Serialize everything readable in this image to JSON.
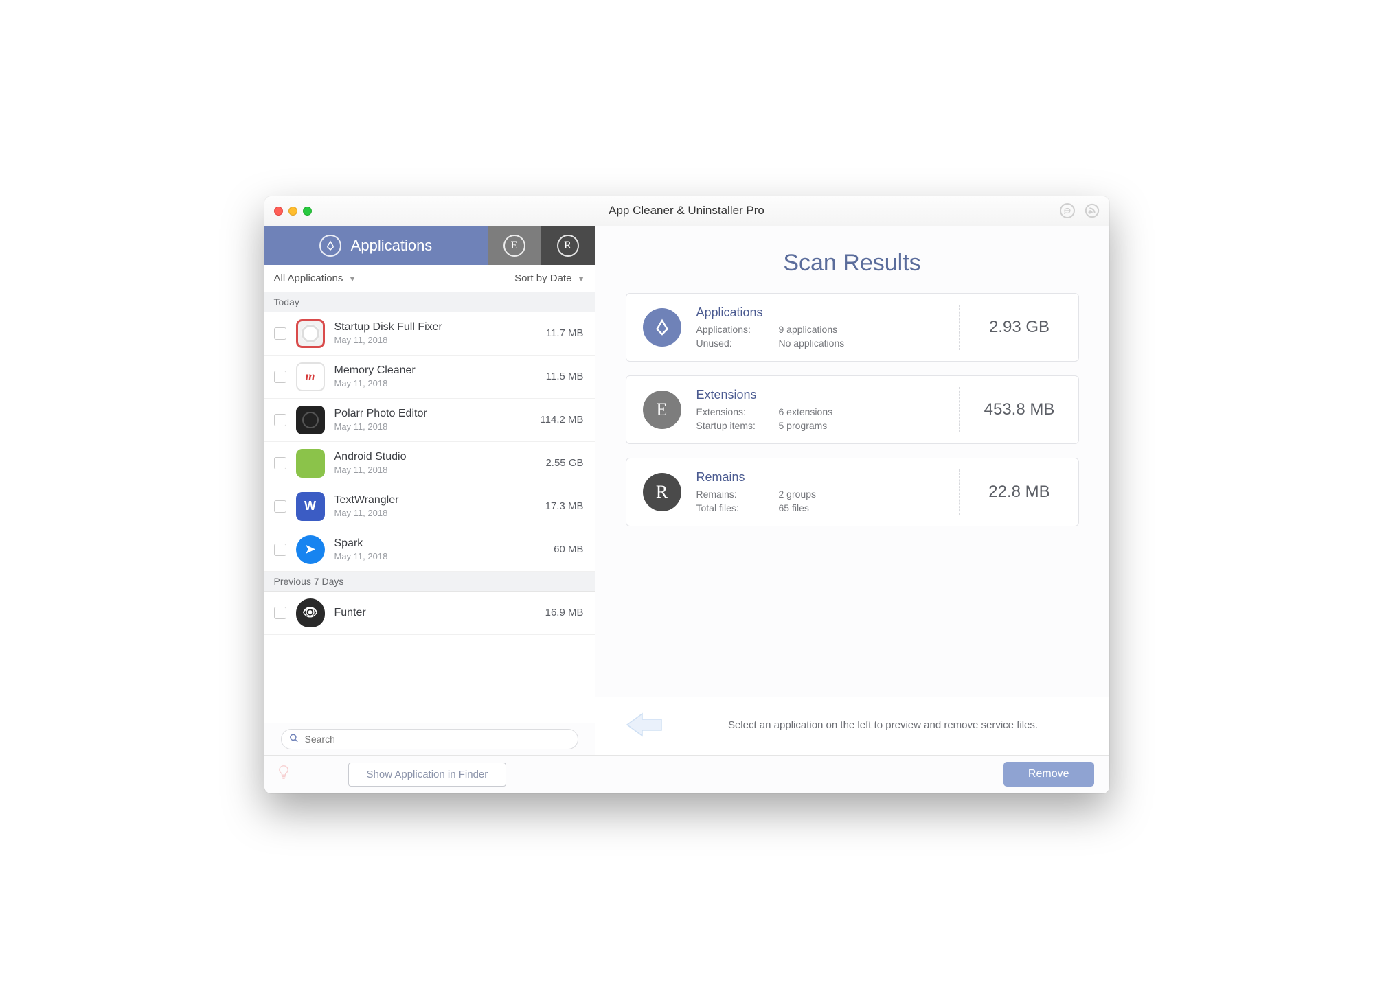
{
  "window_title": "App Cleaner & Uninstaller Pro",
  "tabs": {
    "applications_label": "Applications",
    "ext_glyph": "E",
    "rem_glyph": "R"
  },
  "filters": {
    "left": "All Applications",
    "right": "Sort by Date"
  },
  "sections": {
    "today": "Today",
    "prev7": "Previous 7 Days"
  },
  "apps_today": [
    {
      "name": "Startup Disk Full Fixer",
      "date": "May 11, 2018",
      "size": "11.7 MB",
      "icon": "ic-sdff",
      "glyph": ""
    },
    {
      "name": "Memory Cleaner",
      "date": "May 11, 2018",
      "size": "11.5 MB",
      "icon": "ic-mem",
      "glyph": "m"
    },
    {
      "name": "Polarr Photo Editor",
      "date": "May 11, 2018",
      "size": "114.2 MB",
      "icon": "ic-polarr",
      "glyph": ""
    },
    {
      "name": "Android Studio",
      "date": "May 11, 2018",
      "size": "2.55 GB",
      "icon": "ic-android",
      "glyph": ""
    },
    {
      "name": "TextWrangler",
      "date": "May 11, 2018",
      "size": "17.3 MB",
      "icon": "ic-tw",
      "glyph": "W"
    },
    {
      "name": "Spark",
      "date": "May 11, 2018",
      "size": "60 MB",
      "icon": "ic-spark",
      "glyph": "➤"
    }
  ],
  "apps_prev7": [
    {
      "name": "Funter",
      "date": "",
      "size": "16.9 MB",
      "icon": "ic-funter",
      "glyph": "👁"
    }
  ],
  "search_placeholder": "Search",
  "finder_button": "Show Application in Finder",
  "scan_title": "Scan Results",
  "cards": {
    "apps": {
      "title": "Applications",
      "k1": "Applications:",
      "v1": "9 applications",
      "k2": "Unused:",
      "v2": "No applications",
      "total": "2.93 GB"
    },
    "ext": {
      "title": "Extensions",
      "k1": "Extensions:",
      "v1": "6 extensions",
      "k2": "Startup items:",
      "v2": "5 programs",
      "total": "453.8 MB"
    },
    "rem": {
      "title": "Remains",
      "k1": "Remains:",
      "v1": "2 groups",
      "k2": "Total files:",
      "v2": "65 files",
      "total": "22.8 MB"
    }
  },
  "hint_text": "Select an application on the left to preview and remove service files.",
  "remove_label": "Remove"
}
